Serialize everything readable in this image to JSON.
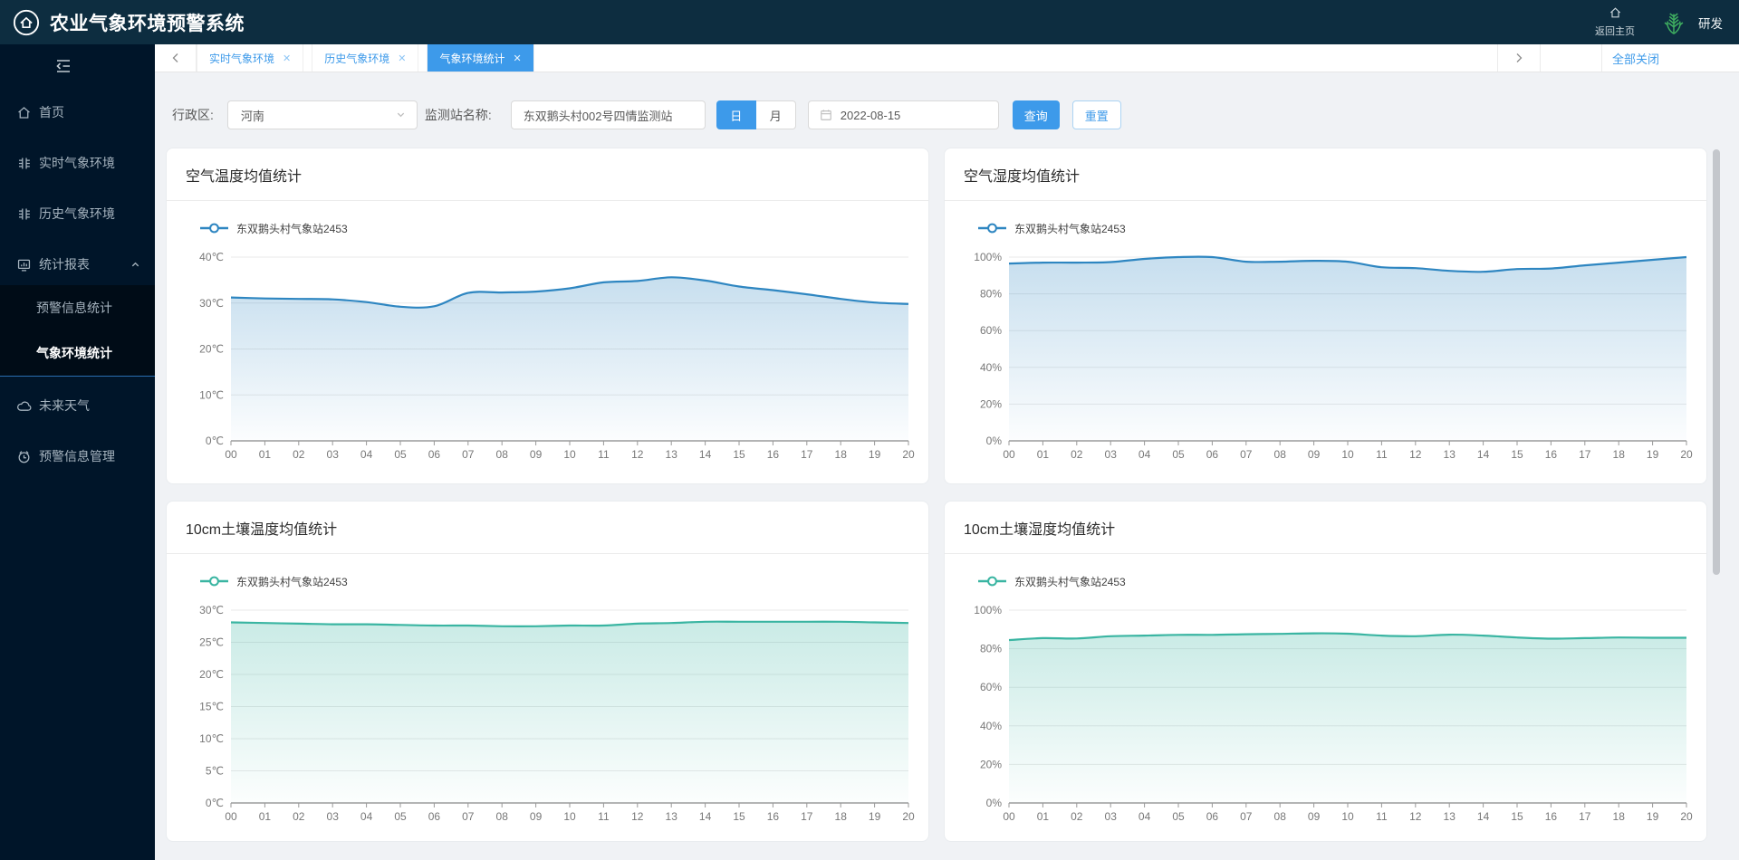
{
  "header": {
    "title": "农业气象环境预警系统",
    "back_home_label": "返回主页",
    "user_name": "研发"
  },
  "tabs": {
    "items": [
      {
        "label": "实时气象环境",
        "active": false
      },
      {
        "label": "历史气象环境",
        "active": false
      },
      {
        "label": "气象环境统计",
        "active": true
      }
    ],
    "close_all_label": "全部关闭"
  },
  "sidebar": {
    "items": [
      {
        "label": "首页",
        "icon": "home-icon"
      },
      {
        "label": "实时气象环境",
        "icon": "realtime-weather-icon"
      },
      {
        "label": "历史气象环境",
        "icon": "history-weather-icon"
      },
      {
        "label": "统计报表",
        "icon": "report-chart-icon",
        "expanded": true,
        "children": [
          {
            "label": "预警信息统计",
            "active": false
          },
          {
            "label": "气象环境统计",
            "active": true
          }
        ]
      },
      {
        "label": "未来天气",
        "icon": "cloud-icon"
      },
      {
        "label": "预警信息管理",
        "icon": "alarm-icon"
      }
    ]
  },
  "filters": {
    "region_label": "行政区:",
    "region_value": "河南",
    "station_label": "监测站名称:",
    "station_value": "东双鹅头村002号四情监测站",
    "day_label": "日",
    "month_label": "月",
    "date_value": "2022-08-15",
    "query_label": "查询",
    "reset_label": "重置"
  },
  "chart_data": [
    {
      "type": "line",
      "title": "空气温度均值统计",
      "series_name": "东双鹅头村气象站2453",
      "unit": "℃",
      "ylim": [
        0,
        40
      ],
      "ytick": 10,
      "color": "#2e86c1",
      "x": [
        "00",
        "01",
        "02",
        "03",
        "04",
        "05",
        "06",
        "07",
        "08",
        "09",
        "10",
        "11",
        "12",
        "13",
        "14",
        "15",
        "16",
        "17",
        "18",
        "19",
        "20"
      ],
      "values": [
        31.2,
        31.0,
        30.9,
        30.8,
        30.2,
        29.2,
        29.3,
        32.2,
        32.3,
        32.5,
        33.2,
        34.5,
        34.8,
        35.6,
        34.9,
        33.6,
        32.8,
        31.9,
        30.9,
        30.1,
        29.8
      ]
    },
    {
      "type": "line",
      "title": "空气湿度均值统计",
      "series_name": "东双鹅头村气象站2453",
      "unit": "%",
      "ylim": [
        0,
        100
      ],
      "ytick": 20,
      "color": "#2e86c1",
      "x": [
        "00",
        "01",
        "02",
        "03",
        "04",
        "05",
        "06",
        "07",
        "08",
        "09",
        "10",
        "11",
        "12",
        "13",
        "14",
        "15",
        "16",
        "17",
        "18",
        "19",
        "20"
      ],
      "values": [
        96.5,
        97,
        97,
        97.3,
        99,
        100,
        100,
        97.5,
        97.5,
        98,
        97.5,
        94.5,
        94,
        92.5,
        92,
        93.5,
        93.8,
        95.5,
        97,
        98.5,
        100
      ]
    },
    {
      "type": "line",
      "title": "10cm土壤温度均值统计",
      "series_name": "东双鹅头村气象站2453",
      "unit": "℃",
      "ylim": [
        0,
        30
      ],
      "ytick": 5,
      "color": "#3ab5a2",
      "x": [
        "00",
        "01",
        "02",
        "03",
        "04",
        "05",
        "06",
        "07",
        "08",
        "09",
        "10",
        "11",
        "12",
        "13",
        "14",
        "15",
        "16",
        "17",
        "18",
        "19",
        "20"
      ],
      "values": [
        28.1,
        28.0,
        27.9,
        27.8,
        27.8,
        27.7,
        27.6,
        27.6,
        27.5,
        27.5,
        27.6,
        27.6,
        27.9,
        28.0,
        28.2,
        28.2,
        28.2,
        28.2,
        28.2,
        28.1,
        28.0
      ]
    },
    {
      "type": "line",
      "title": "10cm土壤湿度均值统计",
      "series_name": "东双鹅头村气象站2453",
      "unit": "%",
      "ylim": [
        0,
        100
      ],
      "ytick": 20,
      "color": "#3ab5a2",
      "x": [
        "00",
        "01",
        "02",
        "03",
        "04",
        "05",
        "06",
        "07",
        "08",
        "09",
        "10",
        "11",
        "12",
        "13",
        "14",
        "15",
        "16",
        "17",
        "18",
        "19",
        "20"
      ],
      "values": [
        84.5,
        85.5,
        85.3,
        86.5,
        86.8,
        87.2,
        87.2,
        87.5,
        87.7,
        88.0,
        87.8,
        86.8,
        86.5,
        87.3,
        86.8,
        85.8,
        85.2,
        85.5,
        85.8,
        85.7,
        85.7
      ]
    }
  ]
}
